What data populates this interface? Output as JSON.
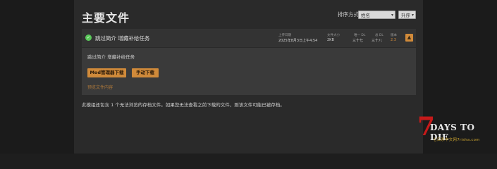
{
  "page": {
    "title": "主要文件"
  },
  "sort": {
    "label": "排序方式",
    "by_selected": "姓名",
    "order_selected": "升序"
  },
  "file": {
    "name": "跳过简介 增藏补给任务",
    "upload_label": "上传日期",
    "upload_value": "2025年8月3日上午4:54",
    "size_label": "文件大小",
    "size_value": "2KB",
    "unique_dl_label": "唯一 DL",
    "unique_dl_value": "三十七",
    "total_dl_label": "总 DL",
    "total_dl_value": "三十八",
    "version_label": "版本",
    "version_value": "2.3",
    "toggle_symbol": "▲",
    "check_symbol": "✓",
    "description": "跳过简介 增藏补给任务",
    "mod_manager_button": "Mod管理器下载",
    "manual_button": "手动下载",
    "preview_link": "预览文件内容"
  },
  "note": "此模组还包含 1 个无法浏览的存档文件。如果您无法查看之前下载的文件，则该文件可能已被存档。",
  "watermark": {
    "mark": "7",
    "title": "DAYS TO DIE",
    "subtitle": "七日杀中文网7risha.com"
  },
  "colors": {
    "accent": "#d08a3a",
    "check": "#5ac95a",
    "logo_red": "#c51a1a"
  }
}
